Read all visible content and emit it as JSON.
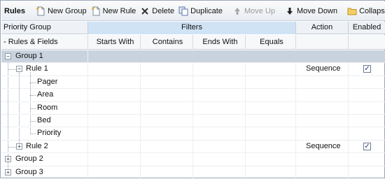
{
  "toolbar": {
    "title": "Rules",
    "new_group": "New Group",
    "new_rule": "New Rule",
    "delete": "Delete",
    "duplicate": "Duplicate",
    "move_up": "Move Up",
    "move_down": "Move Down",
    "collapse_all": "Collapse All"
  },
  "header_top": {
    "priority_group": "Priority Group",
    "filters": "Filters",
    "action": "Action",
    "enabled": "Enabled"
  },
  "header_sub": {
    "rules_fields": "- Rules & Fields",
    "starts_with": "Starts With",
    "contains": "Contains",
    "ends_with": "Ends With",
    "equals": "Equals"
  },
  "tree": {
    "group1": "Group 1",
    "rule1": "Rule 1",
    "rule1_action": "Sequence",
    "rule1_enabled": true,
    "fields": [
      "Pager",
      "Area",
      "Room",
      "Bed",
      "Priority"
    ],
    "rule2": "Rule 2",
    "rule2_action": "Sequence",
    "rule2_enabled": true,
    "group2": "Group 2",
    "group3": "Group 3"
  },
  "colors": {
    "filters_header": "#cfe3f5",
    "group1_row": "#c9d3df"
  }
}
